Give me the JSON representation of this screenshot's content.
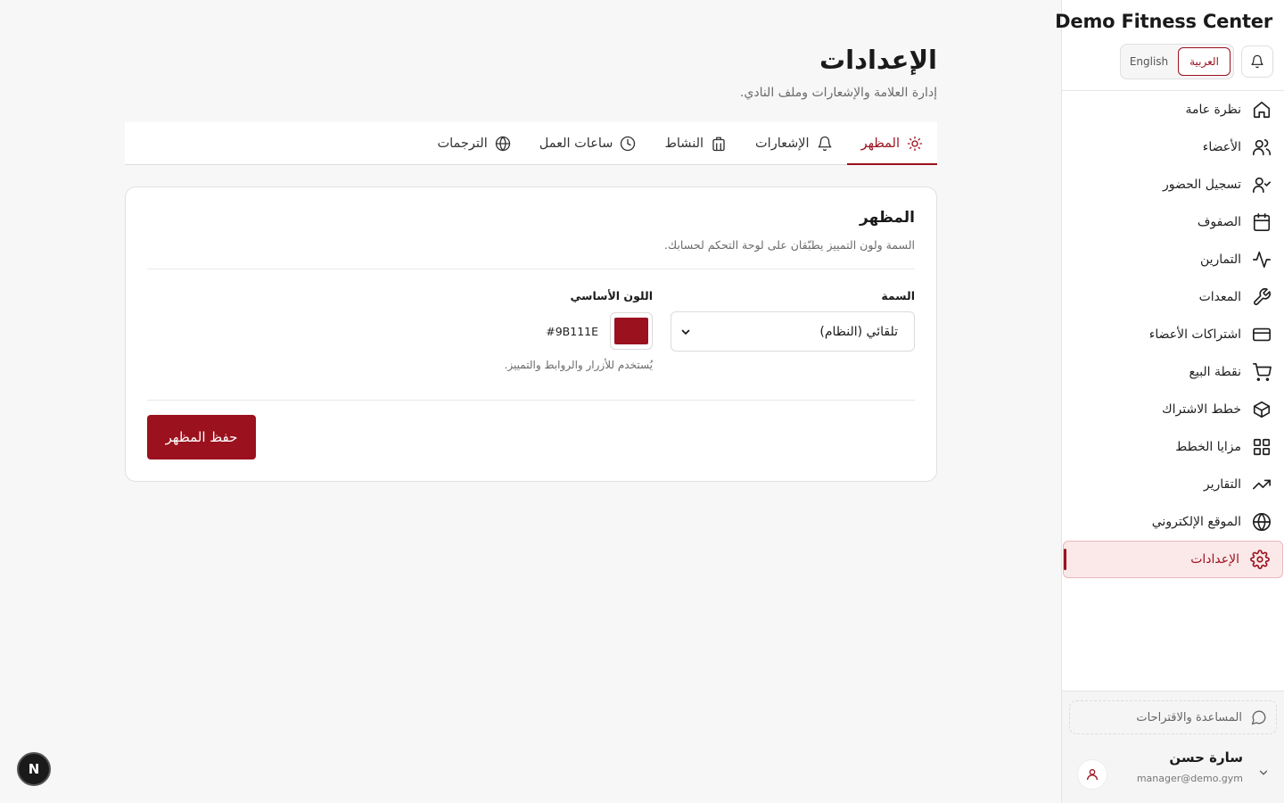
{
  "brand": "Demo Fitness Center",
  "language": {
    "options": [
      "العربية",
      "English"
    ],
    "active": "العربية"
  },
  "nav": [
    {
      "label": "نظرة عامة",
      "icon": "home-icon"
    },
    {
      "label": "الأعضاء",
      "icon": "users-icon"
    },
    {
      "label": "تسجيل الحضور",
      "icon": "user-check-icon"
    },
    {
      "label": "الصفوف",
      "icon": "calendar-icon"
    },
    {
      "label": "التمارين",
      "icon": "activity-icon"
    },
    {
      "label": "المعدات",
      "icon": "wrench-icon"
    },
    {
      "label": "اشتراكات الأعضاء",
      "icon": "credit-card-icon"
    },
    {
      "label": "نقطة البيع",
      "icon": "cart-icon"
    },
    {
      "label": "خطط الاشتراك",
      "icon": "package-icon"
    },
    {
      "label": "مزايا الخطط",
      "icon": "grid-icon"
    },
    {
      "label": "التقارير",
      "icon": "trending-up-icon"
    },
    {
      "label": "الموقع الإلكتروني",
      "icon": "globe-icon"
    },
    {
      "label": "الإعدادات",
      "icon": "settings-icon",
      "active": true
    }
  ],
  "help_label": "المساعدة والاقتراحات",
  "user": {
    "name": "سارة حسن",
    "email": "manager@demo.gym"
  },
  "page": {
    "title": "الإعدادات",
    "subtitle": "إدارة العلامة والإشعارات وملف النادي."
  },
  "tabs": [
    {
      "label": "المظهر",
      "icon": "sun-icon",
      "active": true
    },
    {
      "label": "الإشعارات",
      "icon": "bell-icon"
    },
    {
      "label": "النشاط",
      "icon": "building-icon"
    },
    {
      "label": "ساعات العمل",
      "icon": "clock-icon"
    },
    {
      "label": "الترجمات",
      "icon": "globe-icon"
    }
  ],
  "appearance": {
    "title": "المظهر",
    "description": "السمة ولون التمييز يطبّقان على لوحة التحكم لحسابك.",
    "theme_label": "السمة",
    "theme_value": "تلقائي (النظام)",
    "color_label": "اللون الأساسي",
    "color_value": "#9B111E",
    "color_hint": "يُستخدم للأزرار والروابط والتمييز.",
    "save_label": "حفظ المظهر"
  },
  "dev_badge": "N",
  "colors": {
    "accent": "#9B111E",
    "accent_bg": "#fbe9ea",
    "page_bg": "#f8f7f7"
  }
}
